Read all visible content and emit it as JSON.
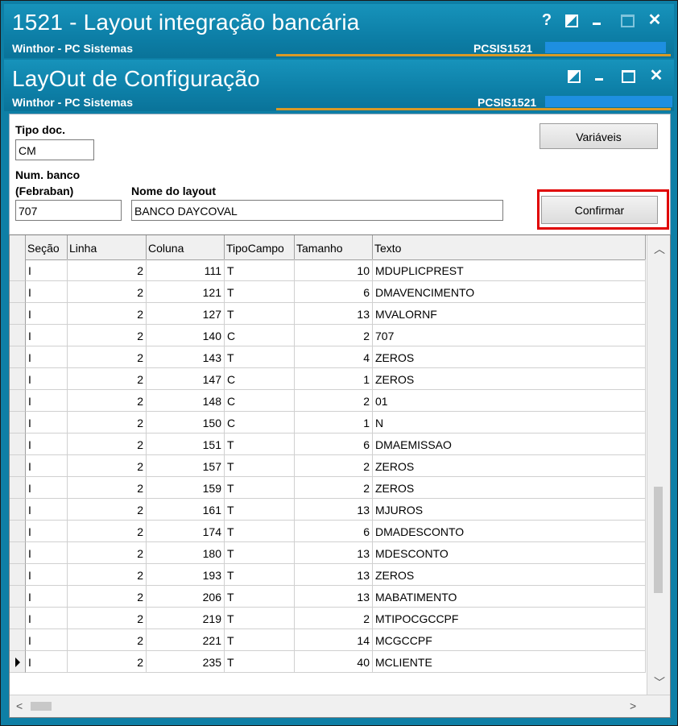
{
  "window1": {
    "title": "1521 - Layout integração bancária",
    "subtitle": "Winthor - PC Sistemas",
    "code": "PCSIS1521",
    "help": "?"
  },
  "window2": {
    "title": "LayOut de Configuração",
    "subtitle": "Winthor - PC Sistemas",
    "code": "PCSIS1521"
  },
  "form": {
    "tipo_doc_label": "Tipo doc.",
    "tipo_doc_value": "CM",
    "num_banco_label_1": "Num. banco",
    "num_banco_label_2": "(Febraban)",
    "num_banco_value": "707",
    "nome_layout_label": "Nome do layout",
    "nome_layout_value": "BANCO DAYCOVAL",
    "variaveis_label": "Variáveis",
    "confirmar_label": "Confirmar"
  },
  "grid": {
    "columns": [
      "Seção",
      "Linha",
      "Coluna",
      "TipoCampo",
      "Tamanho",
      "Texto"
    ],
    "rows": [
      [
        "I",
        "2",
        "111",
        "T",
        "10",
        "MDUPLICPREST"
      ],
      [
        "I",
        "2",
        "121",
        "T",
        "6",
        "DMAVENCIMENTO"
      ],
      [
        "I",
        "2",
        "127",
        "T",
        "13",
        "MVALORNF"
      ],
      [
        "I",
        "2",
        "140",
        "C",
        "2",
        "707"
      ],
      [
        "I",
        "2",
        "143",
        "T",
        "4",
        "ZEROS"
      ],
      [
        "I",
        "2",
        "147",
        "C",
        "1",
        "ZEROS"
      ],
      [
        "I",
        "2",
        "148",
        "C",
        "2",
        "01"
      ],
      [
        "I",
        "2",
        "150",
        "C",
        "1",
        "N"
      ],
      [
        "I",
        "2",
        "151",
        "T",
        "6",
        "DMAEMISSAO"
      ],
      [
        "I",
        "2",
        "157",
        "T",
        "2",
        "ZEROS"
      ],
      [
        "I",
        "2",
        "159",
        "T",
        "2",
        "ZEROS"
      ],
      [
        "I",
        "2",
        "161",
        "T",
        "13",
        "MJUROS"
      ],
      [
        "I",
        "2",
        "174",
        "T",
        "6",
        "DMADESCONTO"
      ],
      [
        "I",
        "2",
        "180",
        "T",
        "13",
        "MDESCONTO"
      ],
      [
        "I",
        "2",
        "193",
        "T",
        "13",
        "ZEROS"
      ],
      [
        "I",
        "2",
        "206",
        "T",
        "13",
        "MABATIMENTO"
      ],
      [
        "I",
        "2",
        "219",
        "T",
        "2",
        "MTIPOCGCCPF"
      ],
      [
        "I",
        "2",
        "221",
        "T",
        "14",
        "MCGCCPF"
      ],
      [
        "I",
        "2",
        "235",
        "T",
        "40",
        "MCLIENTE"
      ]
    ],
    "current_row_index": 18
  },
  "colors": {
    "titlebar": "#0d7fa7",
    "accent_line": "#d89a27",
    "highlight": "#e00000"
  }
}
